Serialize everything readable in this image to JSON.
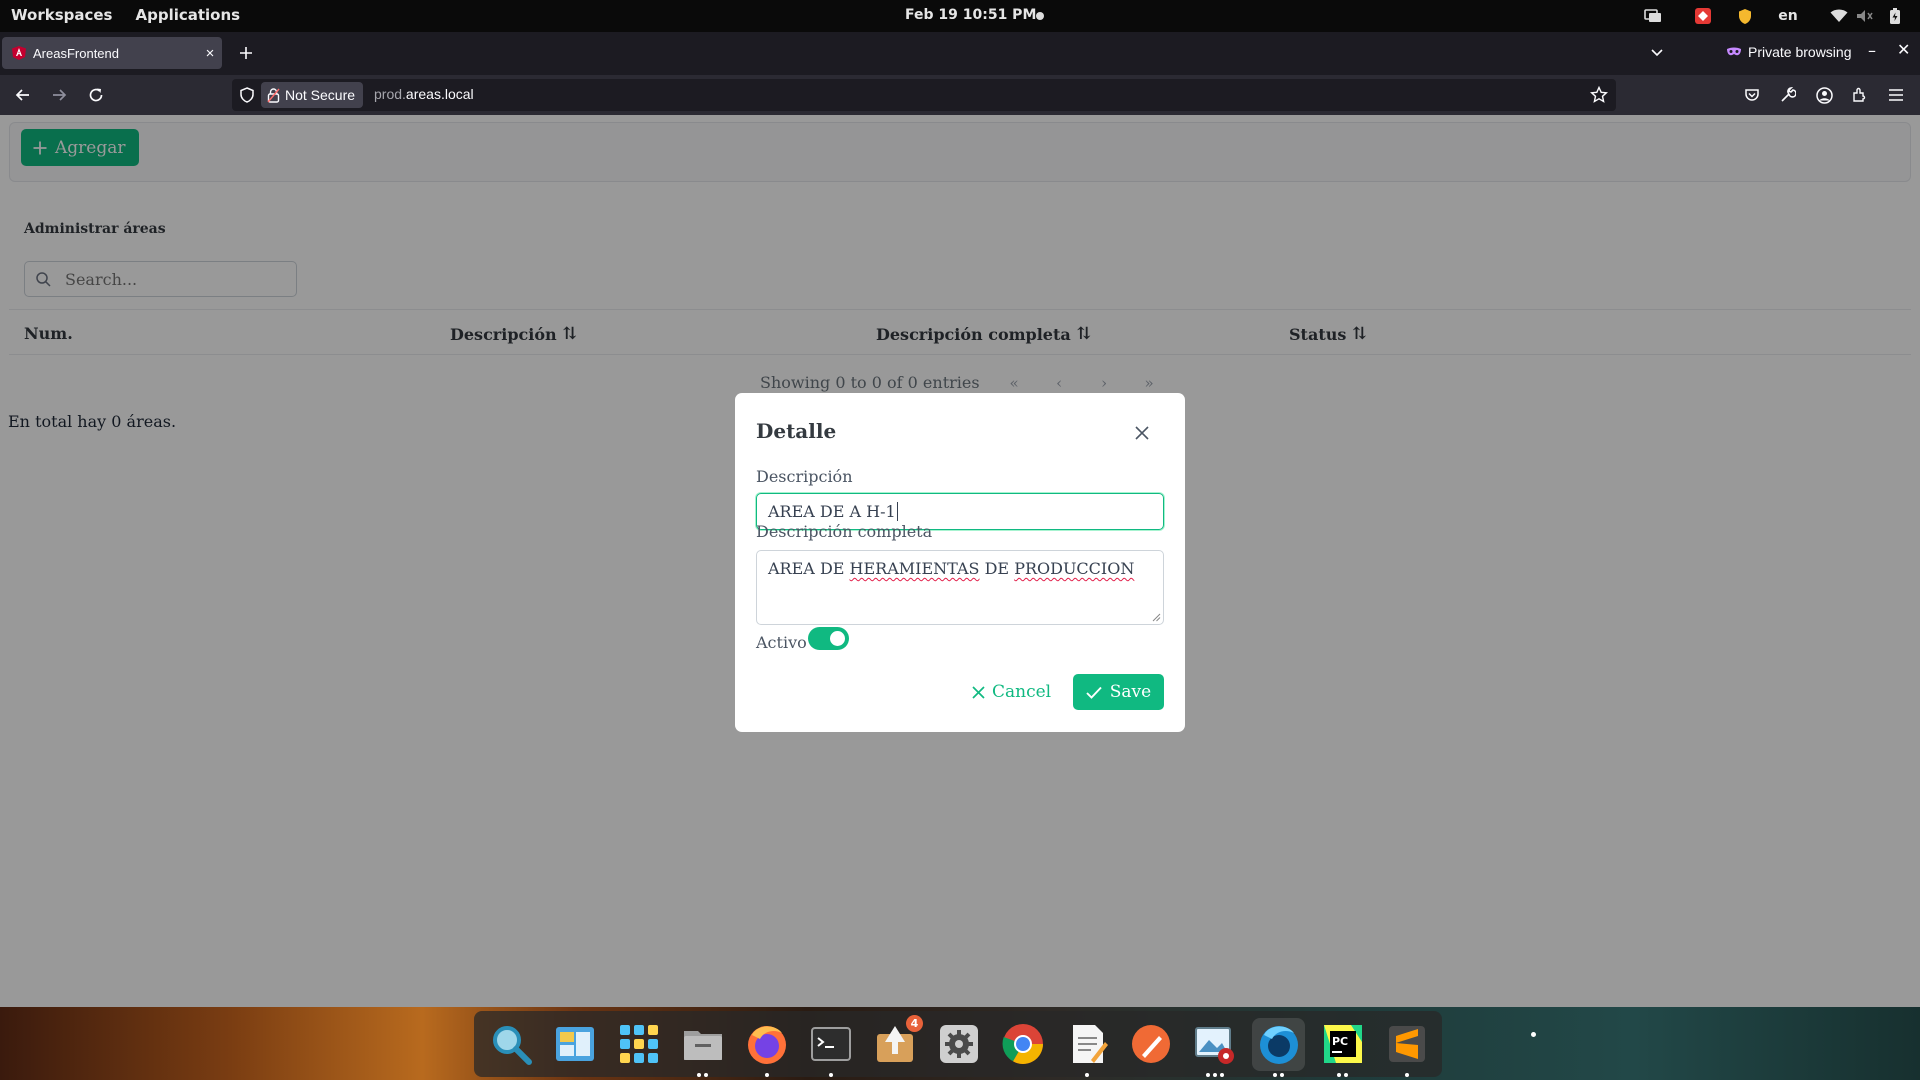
{
  "topbar": {
    "workspaces": "Workspaces",
    "applications": "Applications",
    "clock": "Feb 19  10:51 PM",
    "language": "en"
  },
  "browser": {
    "tab_title": "AreasFrontend",
    "tab_close": "×",
    "private_label": "Private browsing",
    "not_secure": "Not Secure",
    "url_prefix": "prod.",
    "url_domain": "areas.local"
  },
  "page": {
    "add_button": "Agregar",
    "title": "Administrar áreas",
    "search_placeholder": "Search...",
    "columns": [
      {
        "label": "Num.",
        "sortable": false
      },
      {
        "label": "Descripción",
        "sortable": true
      },
      {
        "label": "Descripción completa",
        "sortable": true
      },
      {
        "label": "Status",
        "sortable": true
      }
    ],
    "sort_glyph": "⇅",
    "paginator": {
      "report": "Showing 0 to 0 of 0 entries",
      "first": "«",
      "prev": "‹",
      "next": "›",
      "last": "»"
    },
    "total_text": "En total hay 0 áreas."
  },
  "dialog": {
    "title": "Detalle",
    "desc_label": "Descripción",
    "desc_value": "AREA DE A H-1",
    "full_label": "Descripción completa",
    "full_value_words": [
      "AREA",
      "DE",
      "HERAMIENTAS",
      "DE",
      "PRODUCCION"
    ],
    "active_label": "Activo",
    "active": true,
    "cancel": "Cancel",
    "save": "Save",
    "accent": "#10b981"
  },
  "dock": {
    "apps": [
      {
        "name": "search-app",
        "dots": 0
      },
      {
        "name": "file-roller",
        "dots": 0
      },
      {
        "name": "app-grid",
        "dots": 0
      },
      {
        "name": "files",
        "dots": 2
      },
      {
        "name": "firefox",
        "dots": 1
      },
      {
        "name": "terminal",
        "dots": 1
      },
      {
        "name": "software-updater",
        "dots": 0,
        "badge": "4"
      },
      {
        "name": "settings",
        "dots": 0
      },
      {
        "name": "chrome",
        "dots": 0
      },
      {
        "name": "text-editor",
        "dots": 1
      },
      {
        "name": "inkscape",
        "dots": 0
      },
      {
        "name": "image-viewer",
        "dots": 3
      },
      {
        "name": "firefox-dev",
        "dots": 2,
        "active": true
      },
      {
        "name": "pycharm",
        "dots": 2
      },
      {
        "name": "sublime-text",
        "dots": 1
      }
    ]
  }
}
